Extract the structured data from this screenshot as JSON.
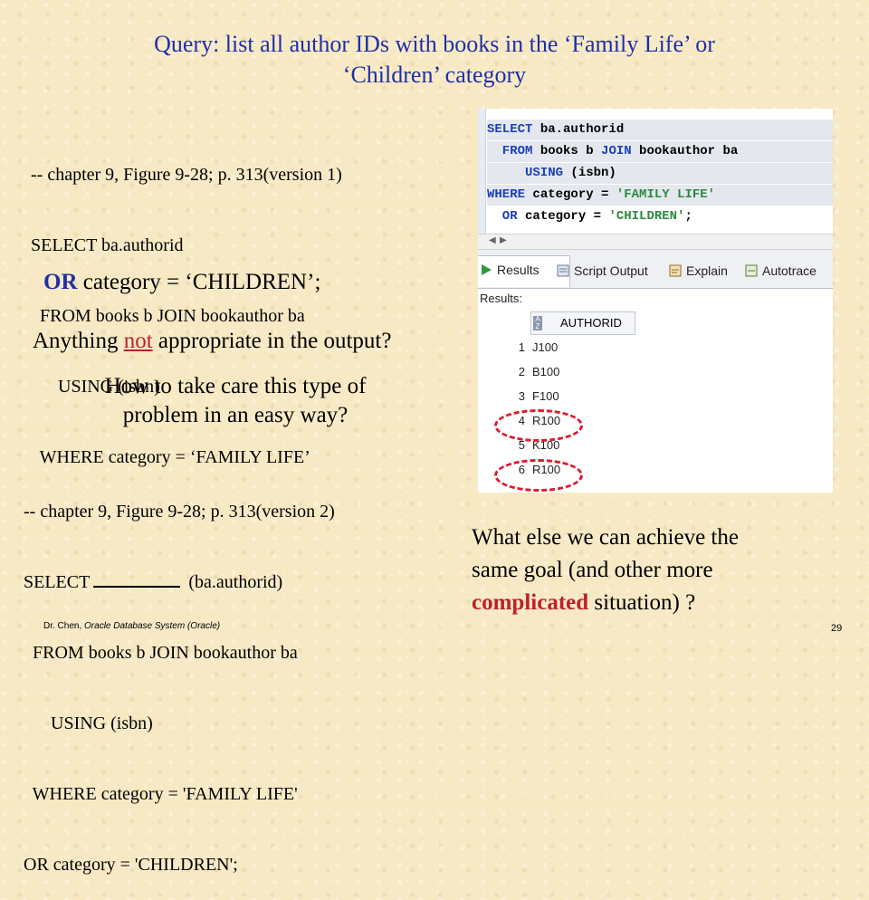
{
  "title": {
    "line1": "Query: list all author IDs with books in the ‘Family Life’ or",
    "line2": "‘Children’ category"
  },
  "code_v1": {
    "l1": "-- chapter 9, Figure 9-28; p. 313(version 1)",
    "l2": "SELECT ba.authorid",
    "l3": "  FROM books b JOIN bookauthor ba",
    "l4": "      USING (isbn)",
    "l5": "  WHERE category = ‘FAMILY LIFE’",
    "or_kw": "OR",
    "or_rest": " category = ‘CHILDREN’;"
  },
  "question1": {
    "pre": "Anything ",
    "emph": "not",
    "post": " appropriate in the output?"
  },
  "question2": {
    "line1": "How to take care this type of",
    "line2": "problem in an easy way?"
  },
  "code_v2": {
    "l1": "-- chapter 9, Figure 9-28; p. 313(version 2)",
    "l2a": "SELECT",
    "l2b": "(ba.authorid)",
    "l3": "  FROM books b JOIN bookauthor ba",
    "l4": "      USING (isbn)",
    "l5": "  WHERE category = 'FAMILY LIFE'",
    "l6": "OR category = 'CHILDREN';"
  },
  "question3": {
    "line1": "What else we can achieve the",
    "line2": "same goal (and other more",
    "comp": "complicated",
    "line3_rest": " situation) ?"
  },
  "sql_editor": {
    "lines": [
      {
        "kw": "SELECT",
        "rest": " ba.authorid"
      },
      {
        "kw": "  FROM",
        "rest": " books b ",
        "kw2": "JOIN",
        "rest2": " bookauthor ba"
      },
      {
        "kw": "     USING",
        "rest": " (isbn)"
      },
      {
        "kw": "WHERE",
        "rest": " category = ",
        "str": "'FAMILY LIFE'"
      },
      {
        "kw": "  OR",
        "rest": " category = ",
        "str": "'CHILDREN'",
        "tail": ";"
      }
    ],
    "tabs": [
      "Results",
      "Script Output",
      "Explain",
      "Autotrace"
    ],
    "results_label": "Results:",
    "column_header": "AUTHORID",
    "rows": [
      {
        "n": "1",
        "v": "J100"
      },
      {
        "n": "2",
        "v": "B100"
      },
      {
        "n": "3",
        "v": "F100"
      },
      {
        "n": "4",
        "v": "R100"
      },
      {
        "n": "5",
        "v": "K100"
      },
      {
        "n": "6",
        "v": "R100"
      }
    ]
  },
  "footer": {
    "author": "Dr. Chen, ",
    "course": "Oracle Database System (Oracle)",
    "page": "29"
  },
  "colors": {
    "title_blue": "#1f2fa8",
    "emphasis_red": "#c0202a",
    "circle_red": "#e0182c",
    "background": "#f7e9c4"
  }
}
